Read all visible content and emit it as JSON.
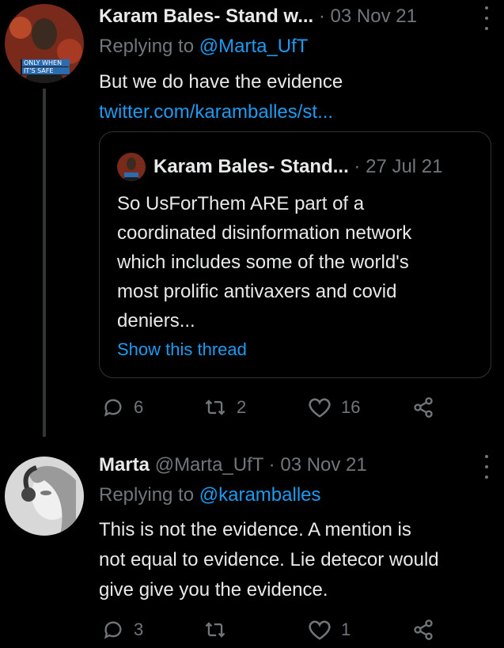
{
  "tweets": [
    {
      "name": "Karam Bales- Stand w...",
      "handle": "",
      "dot": "·",
      "date": "03 Nov 21",
      "reply_prefix": "Replying to ",
      "reply_to": "@Marta_UfT",
      "text": "But we do have the evidence",
      "link": "twitter.com/karamballes/st...",
      "avatar_badge": {
        "line1": "ONLY WHEN",
        "line2": "IT'S SAFE"
      },
      "quote": {
        "name": "Karam Bales- Stand...",
        "dot": "·",
        "date": "27 Jul 21",
        "lines": [
          "So UsForThem ARE part of a",
          "coordinated disinformation network",
          "which includes some of the world's",
          "most prolific antivaxers and covid",
          "deniers..."
        ],
        "show_thread": "Show this thread"
      },
      "actions": {
        "replies": "6",
        "retweets": "2",
        "likes": "16"
      }
    },
    {
      "name": "Marta",
      "handle": "@Marta_UfT",
      "dot": "·",
      "date": "03 Nov 21",
      "reply_prefix": "Replying to ",
      "reply_to": "@karamballes",
      "lines": [
        "This is not the evidence. A mention is",
        "not equal to evidence. Lie detecor would",
        "give give you the evidence."
      ],
      "actions": {
        "replies": "3",
        "retweets": "",
        "likes": "1"
      }
    }
  ],
  "colors": {
    "background": "#000000",
    "text": "#e7e9ea",
    "muted": "#71767b",
    "accent": "#1d9bf0"
  }
}
